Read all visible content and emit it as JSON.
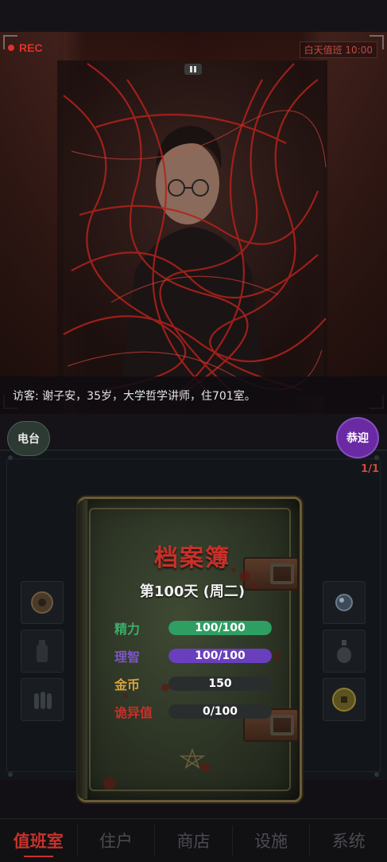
{
  "camera": {
    "rec_label": "REC",
    "shift_label": "白天值班 10:00",
    "visitor_text": "访客: 谢子安，35岁，大学哲学讲师，住701室。"
  },
  "controls": {
    "radio_label": "电台",
    "welcome_label": "恭迎",
    "page_count": "1/1"
  },
  "logbook": {
    "title": "档案簿",
    "day": "第100天 (周二)",
    "stats": [
      {
        "label": "精力",
        "value": "100/100",
        "fraction": 1.0,
        "label_color": "#3fae6b",
        "bar_color": "#2f9e63"
      },
      {
        "label": "理智",
        "value": "100/100",
        "fraction": 1.0,
        "label_color": "#7b56c9",
        "bar_color": "#6a3fbd"
      },
      {
        "label": "金币",
        "value": "150",
        "fraction": 0,
        "label_color": "#d6a23c",
        "bar_color": "#2a2d2e"
      },
      {
        "label": "诡异值",
        "value": "0/100",
        "fraction": 0,
        "label_color": "#c8302a",
        "bar_color": "#2a2d2e"
      }
    ]
  },
  "inventory": {
    "left_slots": [
      "compass-icon",
      "bottle-icon",
      "bullets-icon"
    ],
    "right_slots": [
      "orb-icon",
      "potion-icon",
      "coin-icon"
    ]
  },
  "nav": {
    "items": [
      "值班室",
      "住户",
      "商店",
      "设施",
      "系统"
    ],
    "active_index": 0
  },
  "colors": {
    "accent_red": "#c8322b",
    "welcome_purple": "#6a2aa3"
  }
}
